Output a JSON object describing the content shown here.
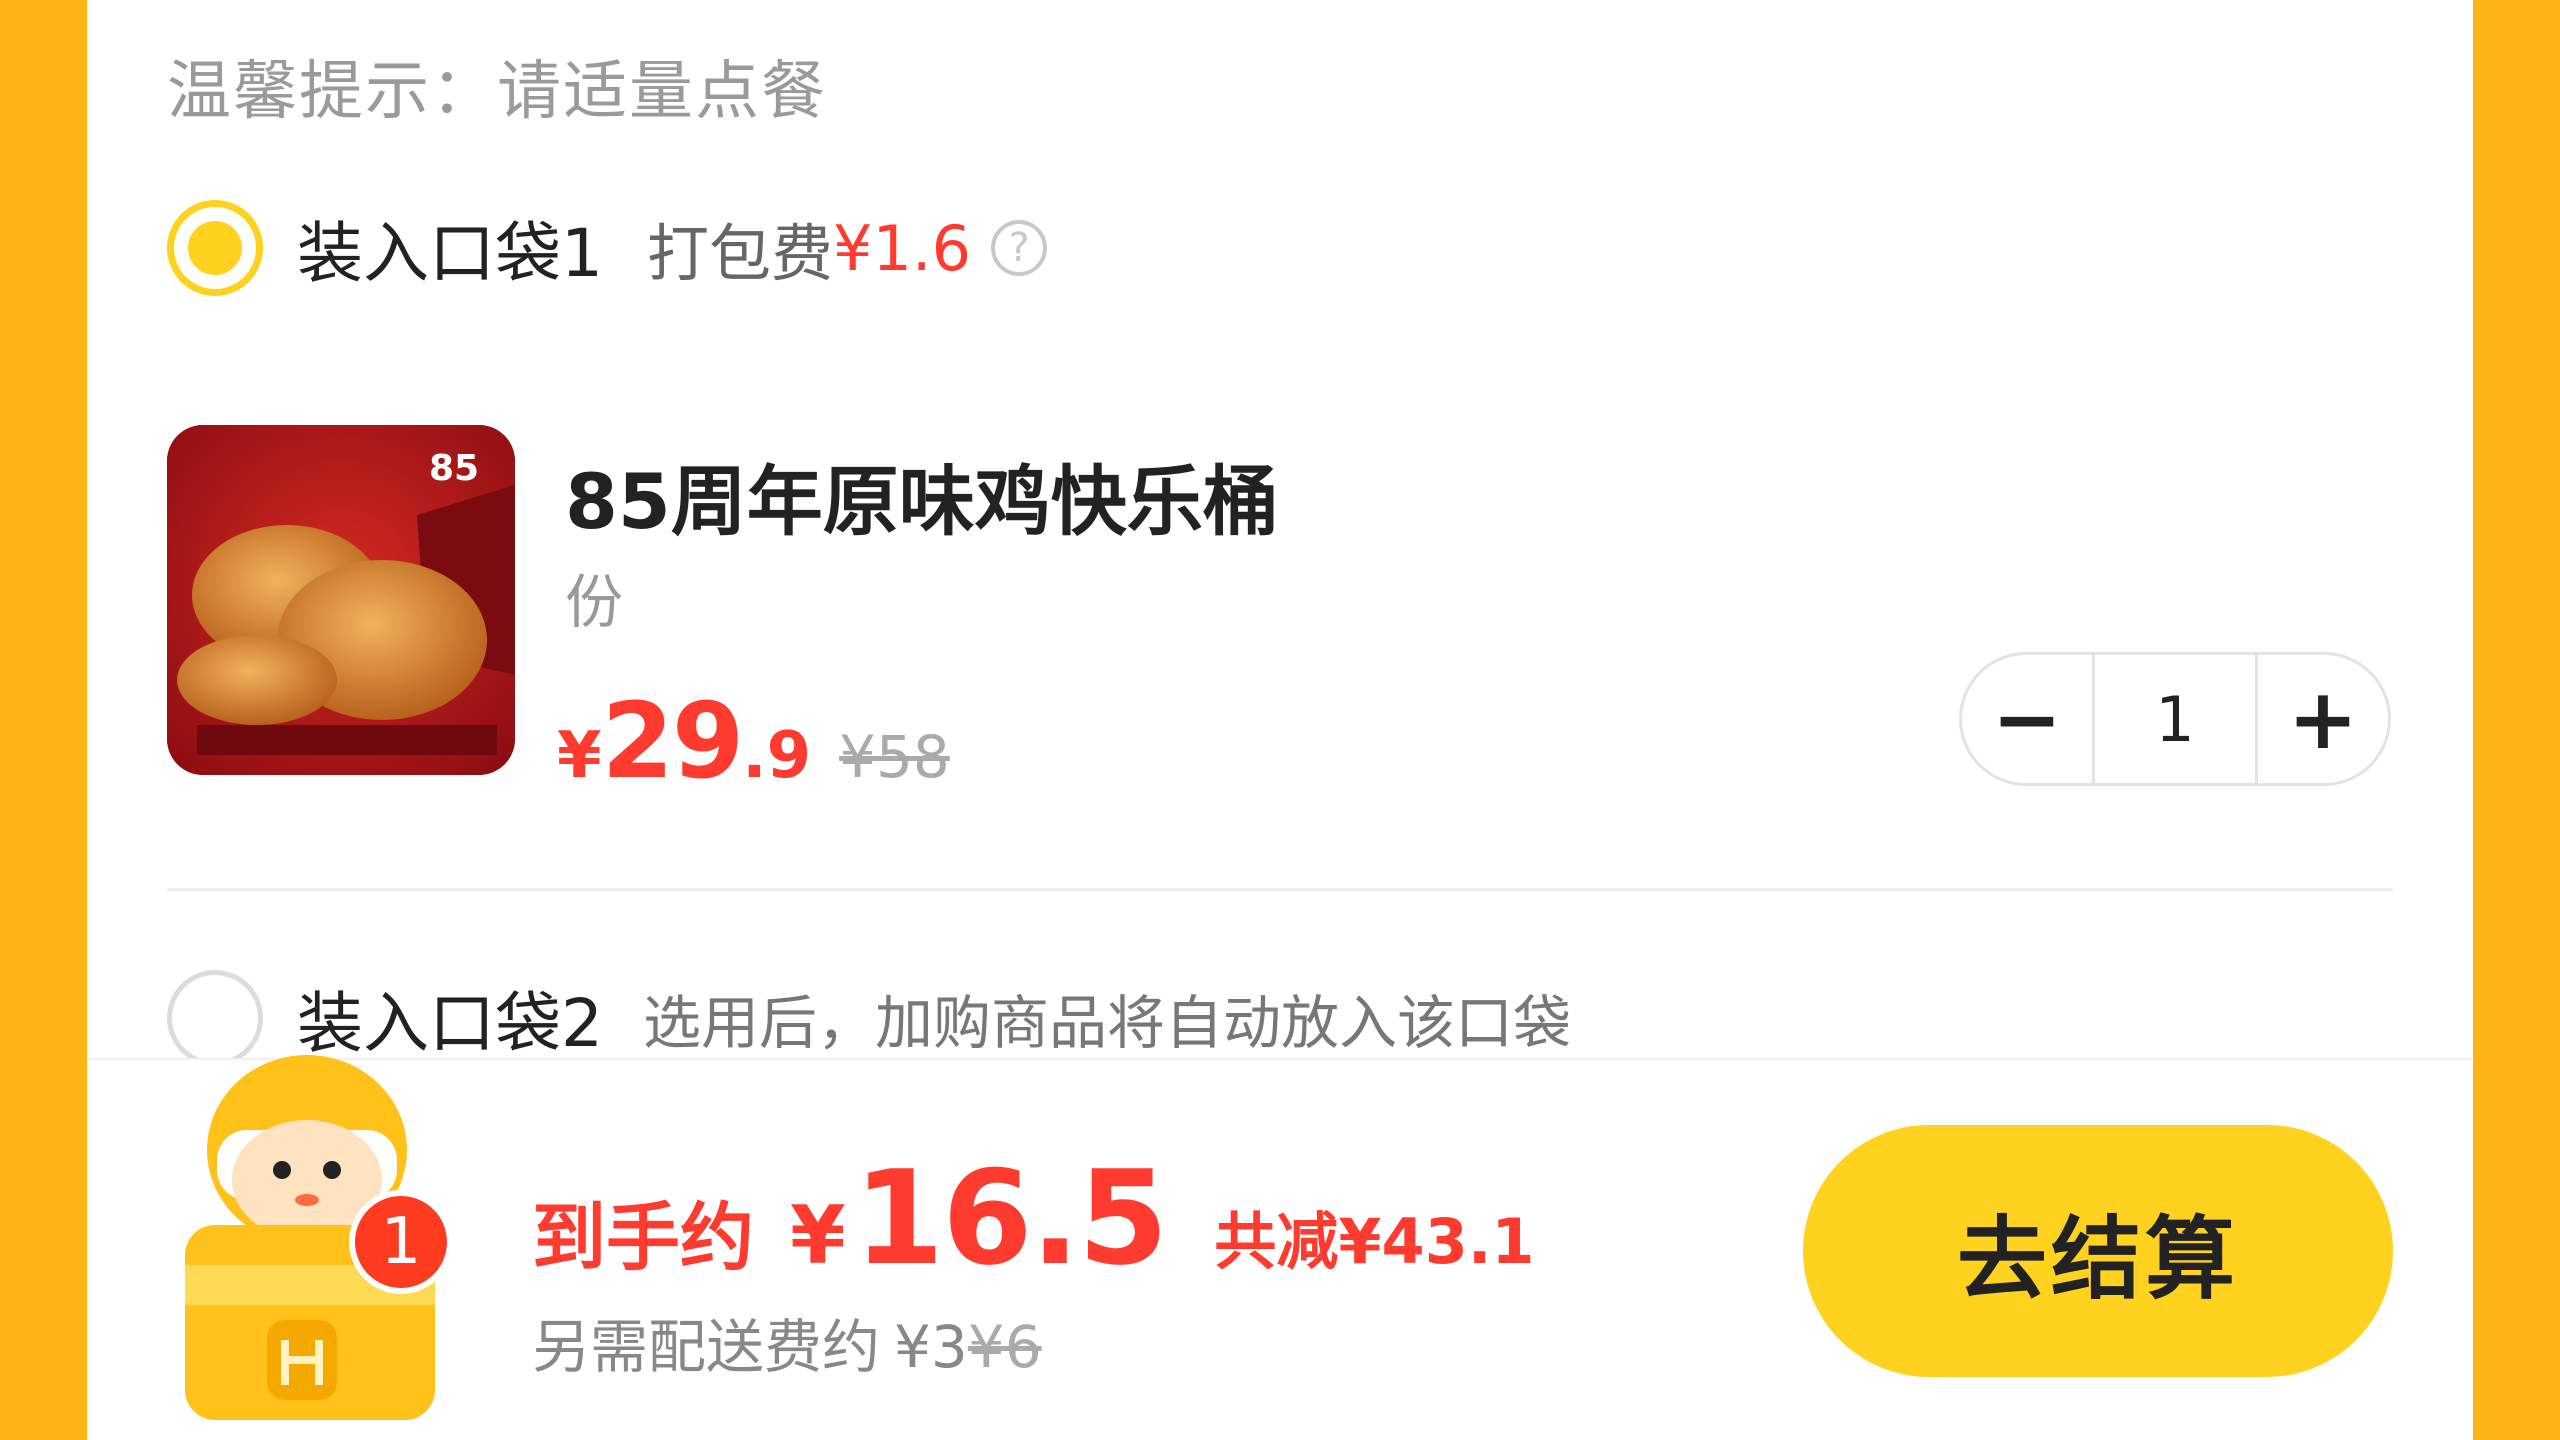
{
  "hint": "温馨提示：请适量点餐",
  "bag1": {
    "title": "装入口袋1",
    "pack_label": "打包费",
    "pack_fee": "¥1.6",
    "help_glyph": "?",
    "selected": true
  },
  "product": {
    "name": "85周年原味鸡快乐桶",
    "unit": "份",
    "price_symbol": "¥",
    "price_int": "29",
    "price_dec": ".9",
    "original_price": "¥58",
    "image_badge": "85",
    "quantity": "1",
    "minus_glyph": "−",
    "plus_glyph": "+"
  },
  "bag2": {
    "title": "装入口袋2",
    "description": "选用后，加购商品将自动放入该口袋",
    "selected": false
  },
  "footer": {
    "cart_count": "1",
    "total_label": "到手约",
    "total_symbol": "¥",
    "total_amount": "16.5",
    "discount": "共减¥43.1",
    "delivery_label": "另需配送费约",
    "delivery_fee": "¥3",
    "delivery_original": "¥6",
    "checkout_label": "去结算"
  },
  "colors": {
    "background": "#FDB515",
    "accent_yellow": "#FFD21F",
    "price_red": "#FF3B30"
  }
}
